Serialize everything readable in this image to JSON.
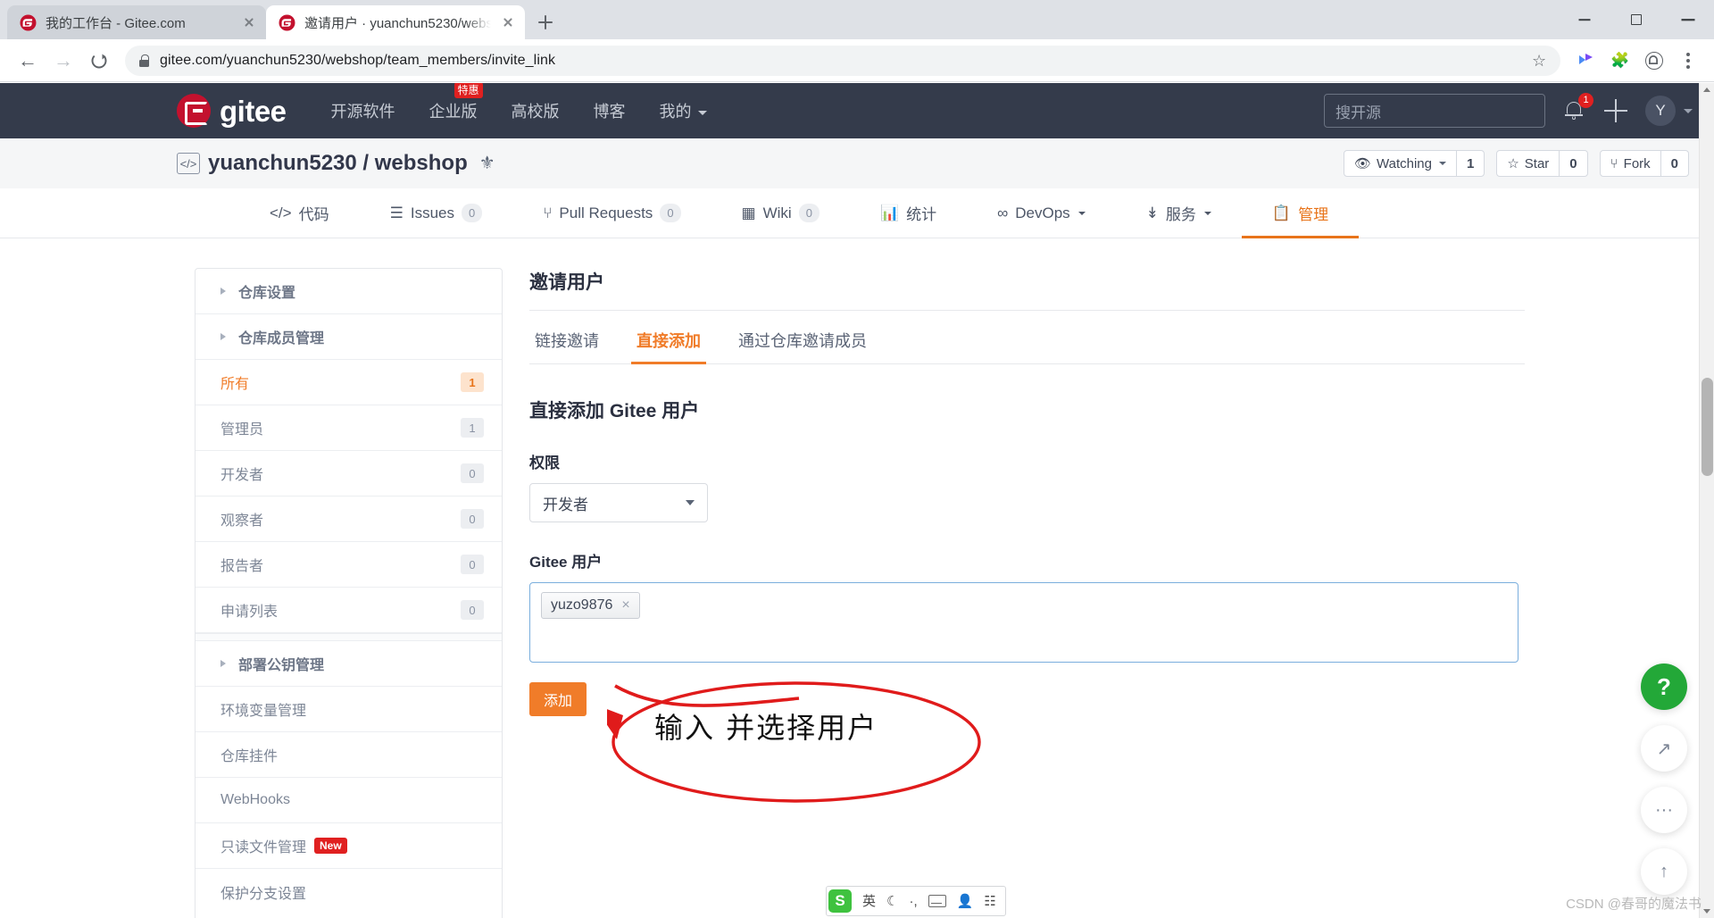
{
  "browser": {
    "tabs": [
      {
        "title": "我的工作台 - Gitee.com",
        "active": false
      },
      {
        "title": "邀请用户 · yuanchun5230/webs",
        "active": true
      }
    ],
    "new_tab_label": "+",
    "url": "gitee.com/yuanchun5230/webshop/team_members/invite_link",
    "window_controls": {
      "minimize": "—",
      "maximize": "□",
      "close": "×"
    }
  },
  "gitee_nav": {
    "logo_text": "gitee",
    "menu": [
      {
        "label": "开源软件",
        "caret": false,
        "badge": ""
      },
      {
        "label": "企业版",
        "caret": false,
        "badge": "特惠"
      },
      {
        "label": "高校版",
        "caret": false,
        "badge": ""
      },
      {
        "label": "博客",
        "caret": false,
        "badge": ""
      },
      {
        "label": "我的",
        "caret": true,
        "badge": ""
      }
    ],
    "search_placeholder": "搜开源",
    "notification_count": "1",
    "avatar_letter": "Y"
  },
  "repo_header": {
    "path": "yuanchun5230 / webshop",
    "actions": [
      {
        "label": "Watching",
        "count": "1",
        "icon": "eye-icon",
        "caret": true
      },
      {
        "label": "Star",
        "count": "0",
        "icon": "star-icon",
        "caret": false
      },
      {
        "label": "Fork",
        "count": "0",
        "icon": "fork-icon",
        "caret": false
      }
    ]
  },
  "repo_tabs": [
    {
      "label": "代码",
      "icon": "code-icon",
      "count": "",
      "active": false,
      "caret": false
    },
    {
      "label": "Issues",
      "icon": "issues-icon",
      "count": "0",
      "active": false,
      "caret": false
    },
    {
      "label": "Pull Requests",
      "icon": "pr-icon",
      "count": "0",
      "active": false,
      "caret": false
    },
    {
      "label": "Wiki",
      "icon": "wiki-icon",
      "count": "0",
      "active": false,
      "caret": false
    },
    {
      "label": "统计",
      "icon": "chart-icon",
      "count": "",
      "active": false,
      "caret": false
    },
    {
      "label": "DevOps",
      "icon": "infinity-icon",
      "count": "",
      "active": false,
      "caret": true
    },
    {
      "label": "服务",
      "icon": "pulse-icon",
      "count": "",
      "active": false,
      "caret": true
    },
    {
      "label": "管理",
      "icon": "manage-icon",
      "count": "",
      "active": true,
      "caret": false
    }
  ],
  "sidebar": [
    {
      "label": "仓库设置",
      "type": "group",
      "badge": "",
      "active": false,
      "new": false
    },
    {
      "label": "仓库成员管理",
      "type": "group",
      "badge": "",
      "active": false,
      "new": false
    },
    {
      "label": "所有",
      "type": "sub",
      "badge": "1",
      "active": true,
      "new": false
    },
    {
      "label": "管理员",
      "type": "sub",
      "badge": "1",
      "active": false,
      "new": false
    },
    {
      "label": "开发者",
      "type": "sub",
      "badge": "0",
      "active": false,
      "new": false
    },
    {
      "label": "观察者",
      "type": "sub",
      "badge": "0",
      "active": false,
      "new": false
    },
    {
      "label": "报告者",
      "type": "sub",
      "badge": "0",
      "active": false,
      "new": false
    },
    {
      "label": "申请列表",
      "type": "sub",
      "badge": "0",
      "active": false,
      "new": false
    },
    {
      "label": "部署公钥管理",
      "type": "group",
      "badge": "",
      "active": false,
      "new": false
    },
    {
      "label": "环境变量管理",
      "type": "sub",
      "badge": "",
      "active": false,
      "new": false
    },
    {
      "label": "仓库挂件",
      "type": "sub",
      "badge": "",
      "active": false,
      "new": false
    },
    {
      "label": "WebHooks",
      "type": "sub",
      "badge": "",
      "active": false,
      "new": false
    },
    {
      "label": "只读文件管理",
      "type": "sub",
      "badge": "",
      "active": false,
      "new": true,
      "new_label": "New"
    },
    {
      "label": "保护分支设置",
      "type": "sub",
      "badge": "",
      "active": false,
      "new": false
    }
  ],
  "main": {
    "page_title": "邀请用户",
    "subtabs": [
      {
        "label": "链接邀请",
        "active": false
      },
      {
        "label": "直接添加",
        "active": true
      },
      {
        "label": "通过仓库邀请成员",
        "active": false
      }
    ],
    "section_title": "直接添加 Gitee 用户",
    "permission_label": "权限",
    "permission_value": "开发者",
    "user_label": "Gitee 用户",
    "user_token": "yuzo9876",
    "token_remove": "×",
    "submit_label": "添加"
  },
  "annotation": {
    "text": "输入 并选择用户",
    "color": "#e01b1b"
  },
  "float_buttons": [
    {
      "icon": "help-icon",
      "glyph": "?",
      "style": "help"
    },
    {
      "icon": "share-icon",
      "glyph": "↗",
      "style": "plain"
    },
    {
      "icon": "feedback-icon",
      "glyph": "···",
      "style": "plain"
    },
    {
      "icon": "scroll-top-icon",
      "glyph": "↑",
      "style": "plain"
    }
  ],
  "ime_bar": {
    "logo": "S",
    "mode": "英",
    "items": [
      "英",
      "☽",
      "·,",
      "keyboard-icon",
      "person-icon",
      "apps-icon"
    ]
  },
  "watermark": "CSDN @春哥的魔法书",
  "colors": {
    "brand_orange": "#f07c29",
    "nav_dark": "#343b4b",
    "gitee_red": "#c3112e",
    "annotation_red": "#e01b1b",
    "help_green": "#23a838"
  }
}
